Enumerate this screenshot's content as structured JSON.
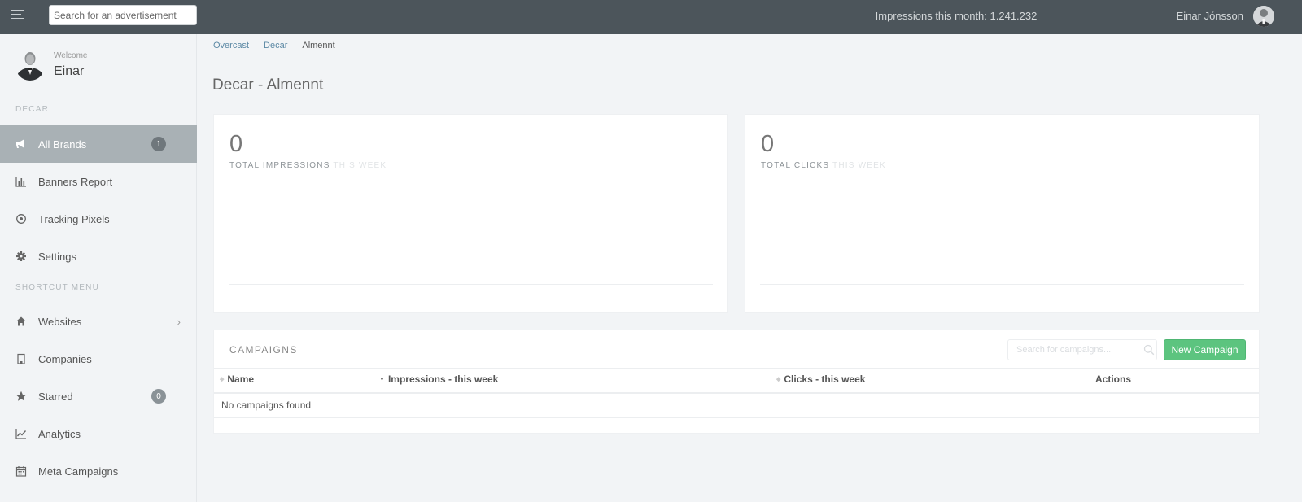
{
  "topbar": {
    "menu_icon": "hamburger-icon",
    "search_placeholder": "Search for an advertisement",
    "impressions_month": "Impressions this month: 1.241.232",
    "user_name": "Einar Jónsson"
  },
  "sidebar": {
    "welcome_label": "Welcome",
    "welcome_name": "Einar",
    "section_decar": "DECAR",
    "section_shortcut": "SHORTCUT MENU",
    "items": [
      {
        "label": "All Brands",
        "icon": "megaphone-icon",
        "badge": "1",
        "active": true
      },
      {
        "label": "Banners Report",
        "icon": "bar-chart-icon"
      },
      {
        "label": "Tracking Pixels",
        "icon": "target-icon"
      },
      {
        "label": "Settings",
        "icon": "gear-icon"
      }
    ],
    "shortcuts": [
      {
        "label": "Websites",
        "icon": "home-icon",
        "chevron": "›"
      },
      {
        "label": "Companies",
        "icon": "building-icon"
      },
      {
        "label": "Starred",
        "icon": "star-icon",
        "badge": "0"
      },
      {
        "label": "Analytics",
        "icon": "line-chart-icon"
      },
      {
        "label": "Meta Campaigns",
        "icon": "calendar-icon"
      }
    ]
  },
  "breadcrumb": [
    "Overcast",
    "Decar",
    "Almennt"
  ],
  "page_title": "Decar - Almennt",
  "stats": {
    "impressions": {
      "value": "0",
      "label": "TOTAL IMPRESSIONS",
      "sub": "THIS WEEK"
    },
    "clicks": {
      "value": "0",
      "label": "TOTAL CLICKS",
      "sub": "THIS WEEK"
    }
  },
  "campaigns": {
    "title": "CAMPAIGNS",
    "search_placeholder": "Search for campaigns...",
    "new_button": "New Campaign",
    "columns": [
      "Name",
      "Impressions - this week",
      "Clicks - this week",
      "Actions"
    ],
    "empty": "No campaigns found"
  },
  "colors": {
    "topbar": "#4c555b",
    "active_nav": "#a9b1b5",
    "primary_button": "#5cc47f",
    "link": "#5b88a4"
  }
}
